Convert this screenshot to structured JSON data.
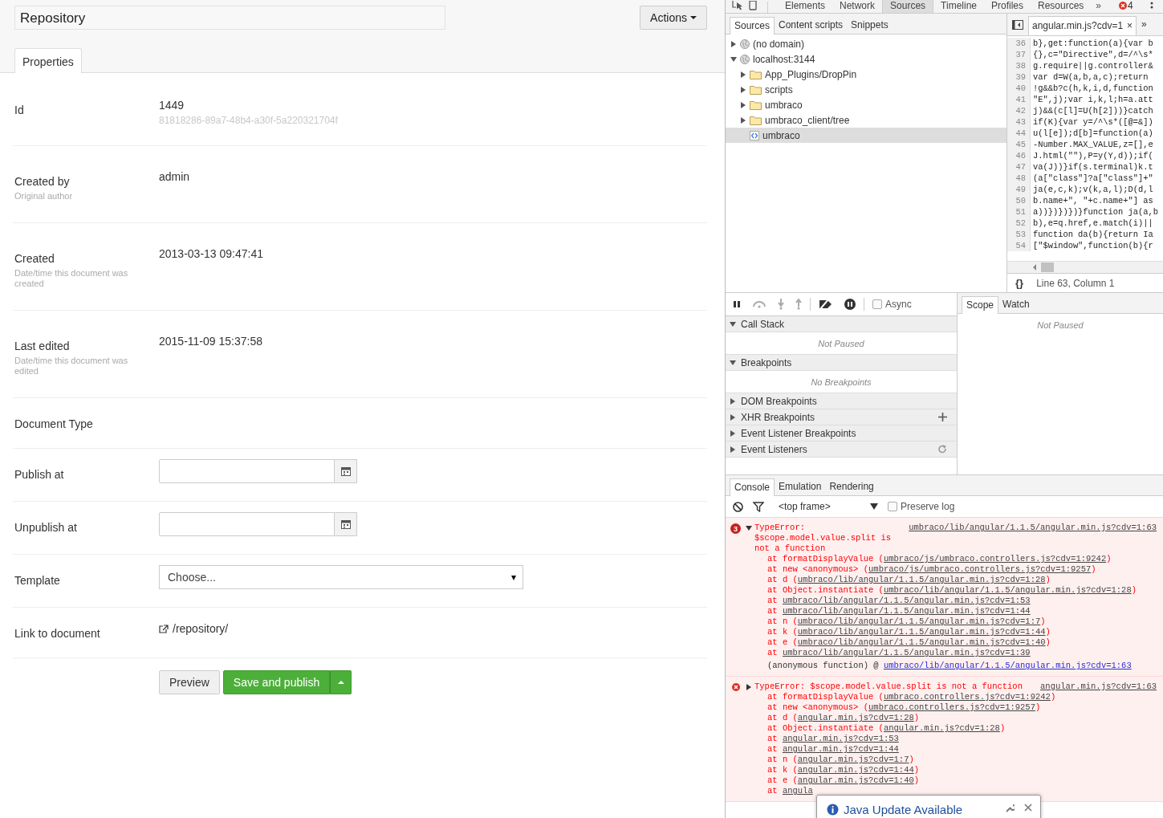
{
  "editor": {
    "name": "Repository",
    "actions_label": "Actions",
    "tabs": [
      {
        "label": "Properties",
        "selected": true
      }
    ],
    "properties": [
      {
        "kind": "text",
        "label": "Id",
        "value": "1449",
        "detail": "81818286-89a7-48b4-a30f-5a220321704f"
      },
      {
        "kind": "text",
        "label": "Created by",
        "description": "Original author",
        "value": "admin"
      },
      {
        "kind": "text",
        "label": "Created",
        "description": "Date/time this document was created",
        "value": "2013-03-13 09:47:41"
      },
      {
        "kind": "text",
        "label": "Last edited",
        "description": "Date/time this document was edited",
        "value": "2015-11-09 15:37:58"
      },
      {
        "kind": "text",
        "label": "Document Type"
      },
      {
        "kind": "date",
        "label": "Publish at"
      },
      {
        "kind": "date",
        "label": "Unpublish at"
      },
      {
        "kind": "select",
        "label": "Template",
        "value": "Choose..."
      },
      {
        "kind": "link",
        "label": "Link to document",
        "value": "/repository/"
      }
    ],
    "buttons": [
      {
        "kind": "default",
        "label": "Preview"
      },
      {
        "kind": "primary",
        "label": "Save and publish",
        "split": true
      }
    ]
  },
  "devtools": {
    "main_tabs": [
      {
        "label": "Elements",
        "selected": false
      },
      {
        "label": "Network",
        "selected": false
      },
      {
        "label": "Sources",
        "selected": true
      },
      {
        "label": "Timeline",
        "selected": false
      },
      {
        "label": "Profiles",
        "selected": false
      },
      {
        "label": "Resources",
        "selected": false
      }
    ],
    "more": "»",
    "error_count": "4",
    "sources": {
      "navigator_tabs": [
        {
          "label": "Sources",
          "selected": true
        },
        {
          "label": "Content scripts",
          "selected": false
        },
        {
          "label": "Snippets",
          "selected": false
        }
      ],
      "tree": [
        {
          "kind": "domain",
          "label": "(no domain)",
          "expanded": false,
          "selected": false
        },
        {
          "kind": "domain",
          "label": "localhost:3144",
          "expanded": true,
          "selected": false,
          "children": [
            {
              "kind": "folder",
              "label": "App_Plugins/DropPin",
              "expanded": false,
              "selected": false
            },
            {
              "kind": "folder",
              "label": "scripts",
              "expanded": false,
              "selected": false
            },
            {
              "kind": "folder",
              "label": "umbraco",
              "expanded": false,
              "selected": false
            },
            {
              "kind": "folder",
              "label": "umbraco_client/tree",
              "expanded": false,
              "selected": false
            },
            {
              "kind": "file",
              "label": "umbraco",
              "selected": true
            }
          ]
        }
      ],
      "editor_tab": {
        "label": "angular.min.js?cdv=1",
        "close": "×"
      },
      "more": "»",
      "lines": [
        {
          "number": "36",
          "code": "b},get:function(a){var b"
        },
        {
          "number": "37",
          "code": "{},c=\"Directive\",d=/^\\s*"
        },
        {
          "number": "38",
          "code": "g.require||g.controller&"
        },
        {
          "number": "39",
          "code": "var d=W(a,b,a,c);return"
        },
        {
          "number": "40",
          "code": "!g&&b?c(h,k,i,d,function"
        },
        {
          "number": "41",
          "code": "\"E\",j);var i,k,l;h=a.att"
        },
        {
          "number": "42",
          "code": "j)&&(c[l]=U(h[2]))}catch"
        },
        {
          "number": "43",
          "code": "if(K){var y=/^\\s*([@=&])"
        },
        {
          "number": "44",
          "code": "u(l[e]);d[b]=function(a)"
        },
        {
          "number": "45",
          "code": "-Number.MAX_VALUE,z=[],e"
        },
        {
          "number": "46",
          "code": "J.html(\"\"),P=y(Y,d));if("
        },
        {
          "number": "47",
          "code": "va(J))}if(s.terminal)k.t"
        },
        {
          "number": "48",
          "code": "(a[\"class\"]?a[\"class\"]+\""
        },
        {
          "number": "49",
          "code": "ja(e,c,k);v(k,a,l);D(d,l"
        },
        {
          "number": "50",
          "code": "b.name+\", \"+c.name+\"] as"
        },
        {
          "number": "51",
          "code": "a))})})})}function ja(a,b"
        },
        {
          "number": "52",
          "code": "b),e=q.href,e.match(i)||"
        },
        {
          "number": "53",
          "code": "function da(b){return Ia"
        },
        {
          "number": "54",
          "code": "[\"$window\",function(b){r"
        }
      ],
      "pretty_print": "{}",
      "status": "Line 63, Column 1"
    },
    "debugger": {
      "async": {
        "label": "Async",
        "checked": false
      },
      "sections": [
        {
          "kind": "plain",
          "title": "Call Stack",
          "expanded": true,
          "message": "Not Paused"
        },
        {
          "kind": "plain",
          "title": "Breakpoints",
          "expanded": true,
          "message": "No Breakpoints"
        },
        {
          "kind": "plain",
          "title": "DOM Breakpoints",
          "expanded": false
        },
        {
          "kind": "add",
          "title": "XHR Breakpoints",
          "expanded": false
        },
        {
          "kind": "plain",
          "title": "Event Listener Breakpoints",
          "expanded": false
        },
        {
          "kind": "refresh",
          "title": "Event Listeners",
          "expanded": false
        }
      ],
      "side_tabs": [
        {
          "label": "Scope",
          "selected": true
        },
        {
          "label": "Watch",
          "selected": false
        }
      ],
      "side_message": "Not Paused"
    },
    "console": {
      "tabs": [
        {
          "label": "Console",
          "selected": true
        },
        {
          "label": "Emulation",
          "selected": false
        },
        {
          "label": "Rendering",
          "selected": false
        }
      ],
      "context": "<top frame>",
      "preserve_log": {
        "label": "Preserve log",
        "checked": false
      },
      "messages": [
        {
          "count": "3",
          "expanded": true,
          "text": "TypeError: $scope.model.value.split is not a function",
          "source": "umbraco/lib/angular/1.1.5/angular.min.js?cdv=1:63",
          "stack": [
            {
              "before": "at formatDisplayValue (",
              "link": "umbraco/js/umbraco.controllers.js?cdv=1:9242",
              "after": ")"
            },
            {
              "before": "at new <anonymous> (",
              "link": "umbraco/js/umbraco.controllers.js?cdv=1:9257",
              "after": ")"
            },
            {
              "before": "at d (",
              "link": "umbraco/lib/angular/1.1.5/angular.min.js?cdv=1:28",
              "after": ")"
            },
            {
              "before": "at Object.instantiate (",
              "link": "umbraco/lib/angular/1.1.5/angular.min.js?cdv=1:28",
              "after": ")"
            },
            {
              "before": "at ",
              "link": "umbraco/lib/angular/1.1.5/angular.min.js?cdv=1:53"
            },
            {
              "before": "at ",
              "link": "umbraco/lib/angular/1.1.5/angular.min.js?cdv=1:44"
            },
            {
              "before": "at n (",
              "link": "umbraco/lib/angular/1.1.5/angular.min.js?cdv=1:7",
              "after": ")"
            },
            {
              "before": "at k (",
              "link": "umbraco/lib/angular/1.1.5/angular.min.js?cdv=1:44",
              "after": ")"
            },
            {
              "before": "at e (",
              "link": "umbraco/lib/angular/1.1.5/angular.min.js?cdv=1:40",
              "after": ")"
            },
            {
              "before": "at ",
              "link": "umbraco/lib/angular/1.1.5/angular.min.js?cdv=1:39"
            }
          ],
          "origin": {
            "text": "(anonymous function) @",
            "link": "umbraco/lib/angular/1.1.5/angular.min.js?cdv=1:63"
          }
        },
        {
          "expanded": false,
          "text": "TypeError: $scope.model.value.split is not a function",
          "source": "angular.min.js?cdv=1:63",
          "stack": [
            {
              "before": "at formatDisplayValue (",
              "link": "umbraco.controllers.js?cdv=1:9242",
              "after": ")"
            },
            {
              "before": "at new <anonymous> (",
              "link": "umbraco.controllers.js?cdv=1:9257",
              "after": ")"
            },
            {
              "before": "at d (",
              "link": "angular.min.js?cdv=1:28",
              "after": ")"
            },
            {
              "before": "at Object.instantiate (",
              "link": "angular.min.js?cdv=1:28",
              "after": ")"
            },
            {
              "before": "at ",
              "link": "angular.min.js?cdv=1:53"
            },
            {
              "before": "at ",
              "link": "angular.min.js?cdv=1:44"
            },
            {
              "before": "at n (",
              "link": "angular.min.js?cdv=1:7",
              "after": ")"
            },
            {
              "before": "at k (",
              "link": "angular.min.js?cdv=1:44",
              "after": ")"
            },
            {
              "before": "at e (",
              "link": "angular.min.js?cdv=1:40",
              "after": ")"
            },
            {
              "before": "at ",
              "link": "angula"
            }
          ]
        }
      ]
    }
  },
  "notification": {
    "title": "Java Update Available"
  }
}
